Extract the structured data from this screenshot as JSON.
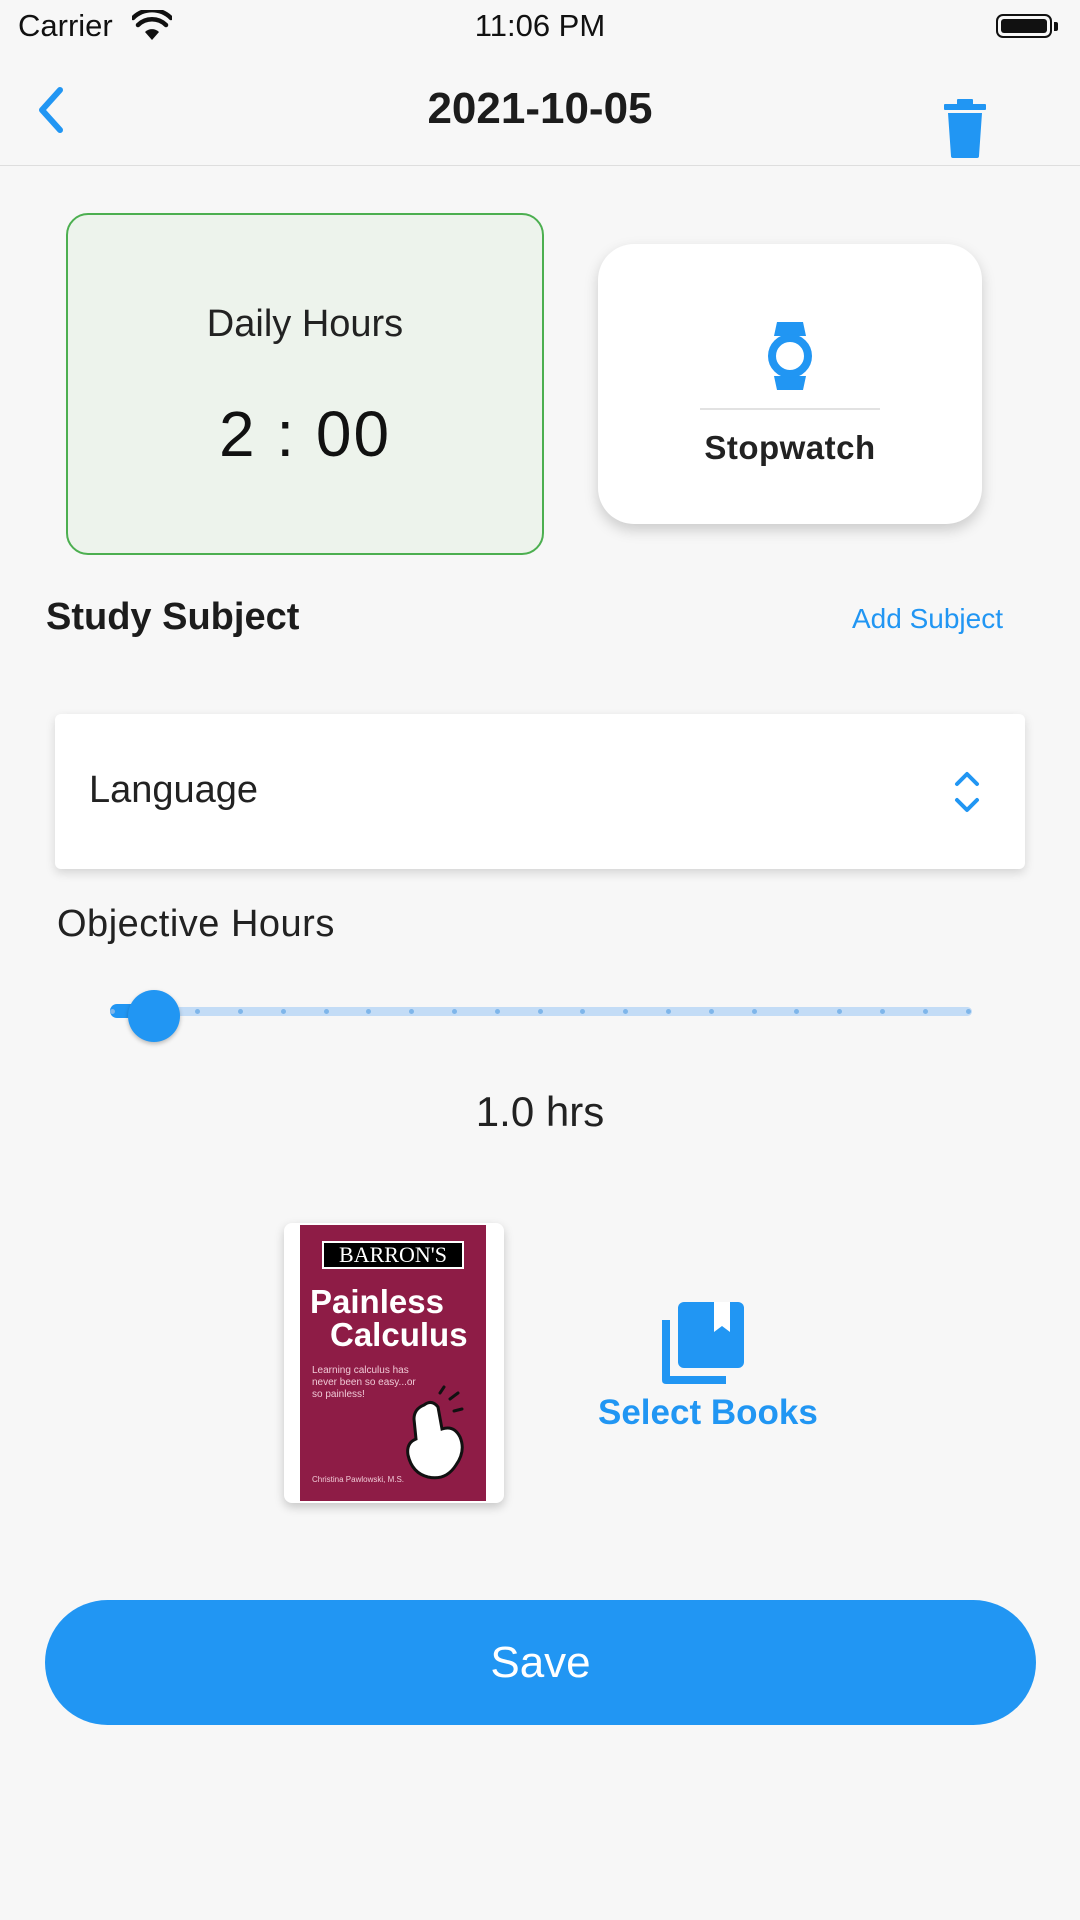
{
  "status_bar": {
    "carrier": "Carrier",
    "time": "11:06 PM"
  },
  "nav": {
    "title": "2021-10-05",
    "back_icon": "chevron-left-icon",
    "delete_icon": "trash-icon"
  },
  "daily_hours": {
    "label": "Daily Hours",
    "value": "2 : 00"
  },
  "stopwatch": {
    "label": "Stopwatch",
    "icon": "watch-icon"
  },
  "study_subject": {
    "title": "Study Subject",
    "add_label": "Add Subject",
    "selected": "Language",
    "chevron_icon": "up-down-chevron-icon"
  },
  "objective": {
    "label": "Objective Hours",
    "value_text": "1.0 hrs",
    "slider_value": 1.0,
    "slider_steps": 20
  },
  "book": {
    "publisher": "BARRON'S",
    "title_line1": "Painless",
    "title_line2": "Calculus",
    "tagline": "Learning calculus has never been so easy...or so painless!",
    "author": "Christina Pawlowski, M.S."
  },
  "select_books": {
    "label": "Select Books",
    "icon": "library-books-icon"
  },
  "save": {
    "label": "Save"
  },
  "colors": {
    "accent": "#2196f3",
    "daily_border": "#4caf50",
    "daily_bg": "#edf3ec"
  }
}
